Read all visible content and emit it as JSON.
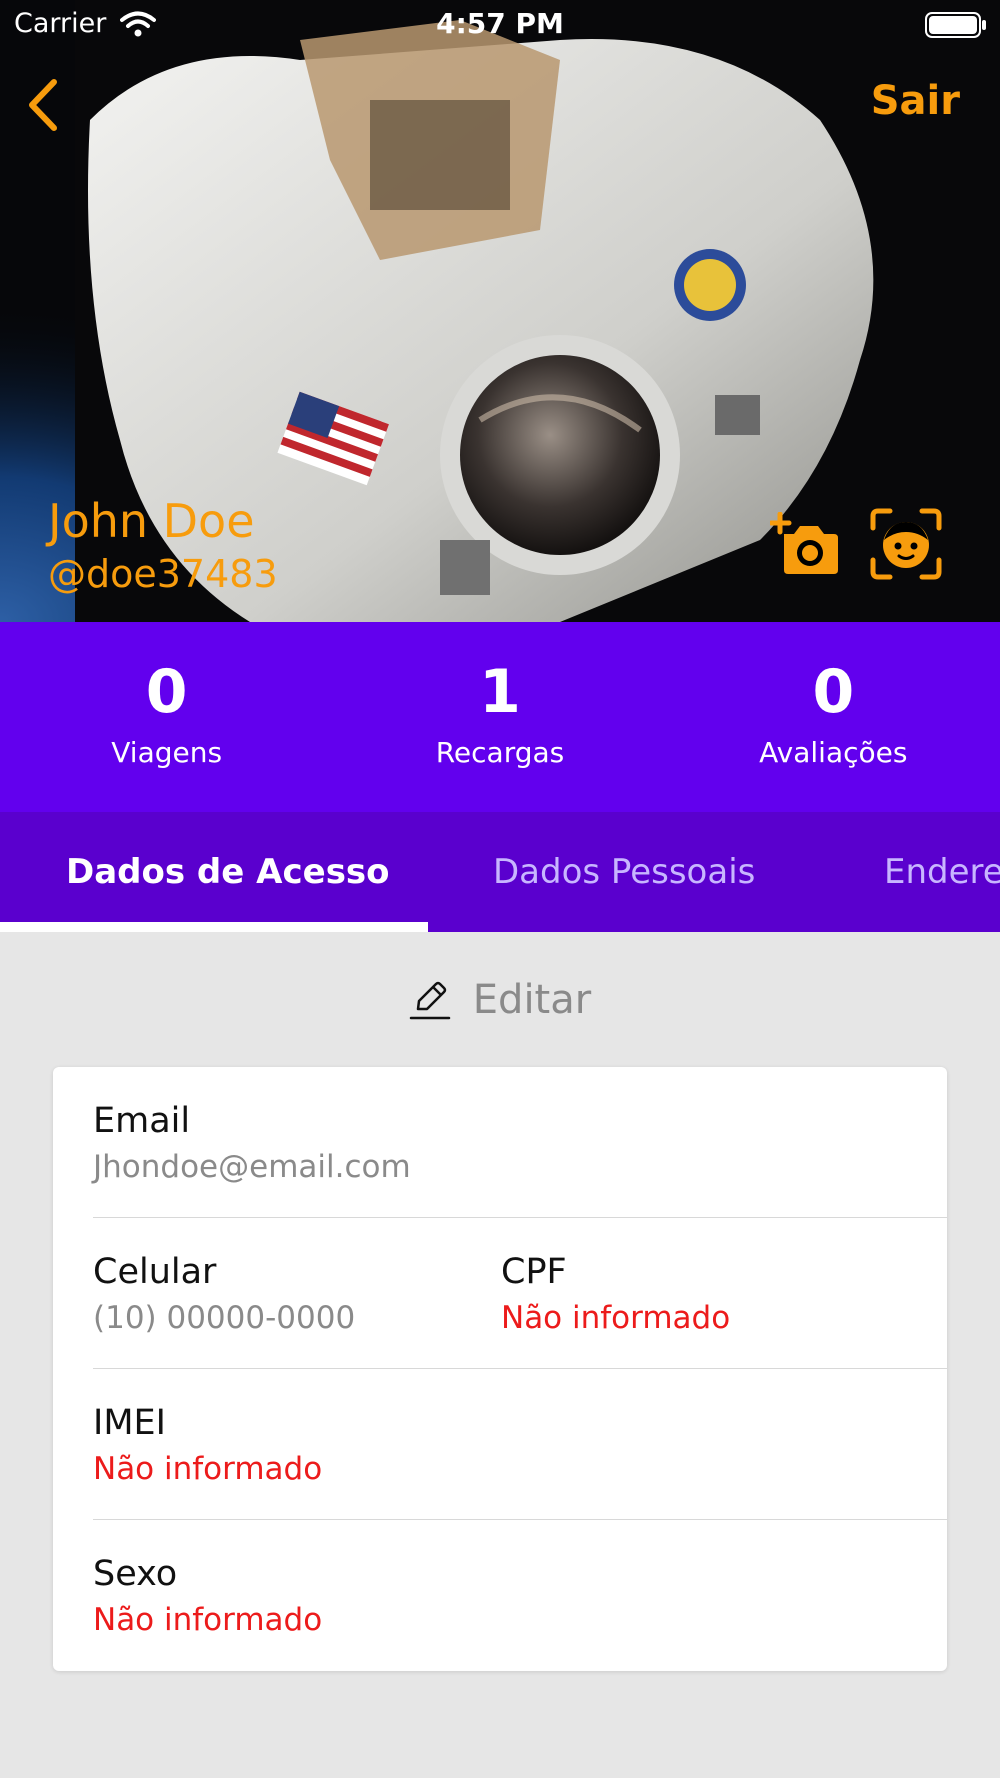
{
  "status_bar": {
    "carrier": "Carrier",
    "time": "4:57 PM"
  },
  "header": {
    "logout_label": "Sair",
    "accent_color": "#f79c0d"
  },
  "profile": {
    "name": "John Doe",
    "handle": "@doe37483"
  },
  "stats": [
    {
      "value": "0",
      "label": "Viagens"
    },
    {
      "value": "1",
      "label": "Recargas"
    },
    {
      "value": "0",
      "label": "Avaliações"
    }
  ],
  "tabs": [
    {
      "label": "Dados de Acesso",
      "active": true
    },
    {
      "label": "Dados Pessoais",
      "active": false
    },
    {
      "label": "Endereço",
      "active": false
    }
  ],
  "edit_label": "Editar",
  "fields": {
    "email": {
      "label": "Email",
      "value": "Jhondoe@email.com"
    },
    "celular": {
      "label": "Celular",
      "value": "(10) 00000-0000"
    },
    "cpf": {
      "label": "CPF",
      "value": "Não informado"
    },
    "imei": {
      "label": "IMEI",
      "value": "Não informado"
    },
    "sexo": {
      "label": "Sexo",
      "value": "Não informado"
    }
  },
  "colors": {
    "purple": "#6200ee",
    "tab_bar": "#5a00ce",
    "missing_value": "#ec1b1b"
  },
  "icons": [
    "back-chevron-icon",
    "add-photo-icon",
    "face-scan-icon",
    "pencil-icon",
    "wifi-icon",
    "battery-icon"
  ]
}
